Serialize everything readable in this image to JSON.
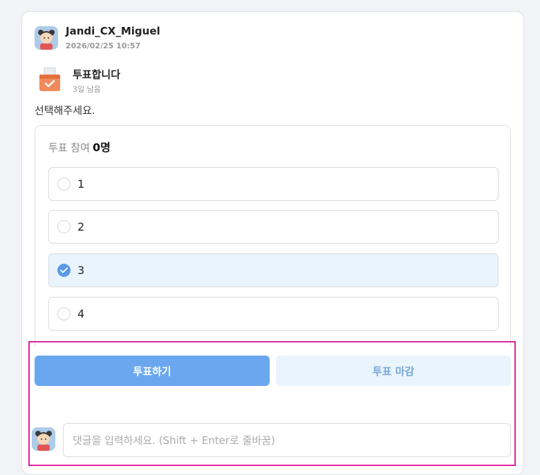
{
  "post": {
    "author": "Jandi_CX_Miguel",
    "timestamp": "2026/02/25 10:57",
    "vote_title": "투표합니다",
    "remaining": "3일 남음",
    "description": "선택해주세요."
  },
  "poll": {
    "participants_label": "투표 참여",
    "participants_count": "0명",
    "options": [
      {
        "label": "1",
        "selected": false
      },
      {
        "label": "2",
        "selected": false
      },
      {
        "label": "3",
        "selected": true
      },
      {
        "label": "4",
        "selected": false
      }
    ]
  },
  "actions": {
    "vote_label": "투표하기",
    "close_label": "투표 마감"
  },
  "comment": {
    "placeholder": "댓글을 입력하세요. (Shift + Enter로 줄바꿈)"
  },
  "colors": {
    "accent": "#6aa7ef",
    "selected_bg": "#eaf4fc",
    "highlight_border": "#e0219b"
  },
  "icons": {
    "avatar": "user-avatar-icon",
    "vote": "ballot-box-icon",
    "check": "check-icon"
  }
}
